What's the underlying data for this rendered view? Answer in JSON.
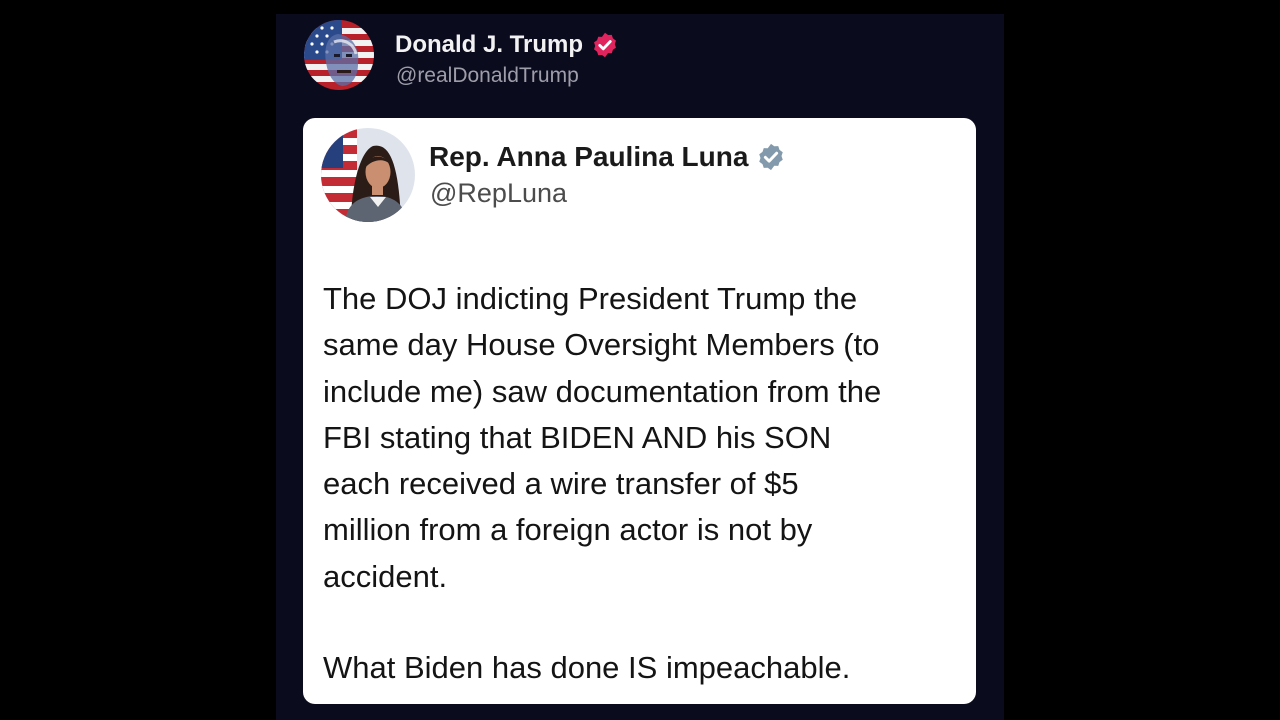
{
  "post": {
    "author_name": "Donald J. Trump",
    "author_handle": "@realDonaldTrump",
    "author_avatar_icon": "american-flag-portrait-avatar",
    "verified_icon": "pink-verified-badge-icon",
    "verified_color": "#e0245e"
  },
  "quoted_post": {
    "author_name": "Rep. Anna Paulina Luna",
    "author_handle": "@RepLuna",
    "author_avatar_icon": "portrait-avatar-with-flag",
    "verified_icon": "gray-verified-badge-icon",
    "verified_color": "#829aab",
    "body": "The DOJ indicting President Trump the\nsame day House Oversight Members (to\ninclude me) saw documentation from the\nFBI stating that BIDEN AND his SON\neach received a wire transfer of $5\nmillion from a foreign actor is not by\naccident.",
    "closing": "What Biden has done IS impeachable."
  },
  "colors": {
    "page_background": "#000000",
    "post_background": "#0b0b1e",
    "card_background": "#ffffff"
  }
}
